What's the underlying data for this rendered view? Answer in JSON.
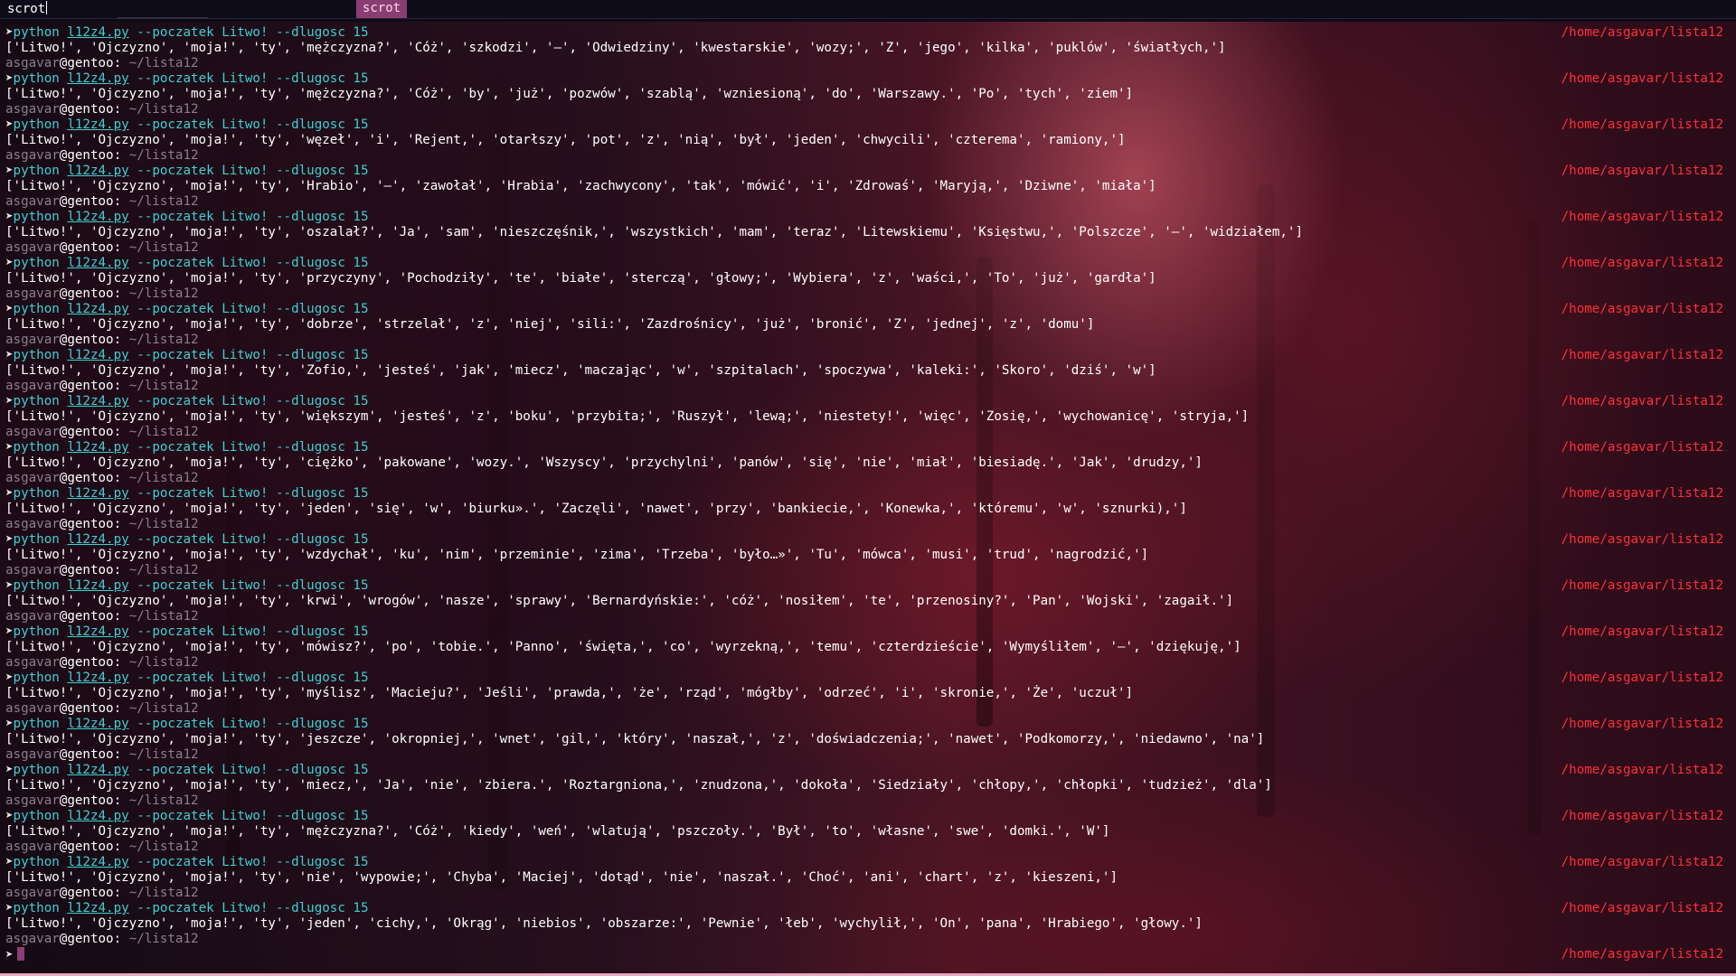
{
  "launcher": {
    "query": "scrot",
    "result": "scrot"
  },
  "terminal": {
    "prompt_char": "➤",
    "user": "asgavar",
    "host": "@gentoo:",
    "cwd": "~/lista12",
    "right_path": "/home/asgavar/lista12",
    "cmd_python": "python",
    "script": "l12z4.py",
    "args": "--poczatek Litwo! --dlugosc 15",
    "outputs": [
      "['Litwo!', 'Ojczyzno', 'moja!', 'ty', 'mężczyzna?', 'Cóż', 'szkodzi', '—', 'Odwiedziny', 'kwestarskie', 'wozy;', 'Z', 'jego', 'kilka', 'puklów', 'światłych,']",
      "['Litwo!', 'Ojczyzno', 'moja!', 'ty', 'mężczyzna?', 'Cóż', 'by', 'już', 'pozwów', 'szablą', 'wzniesioną', 'do', 'Warszawy.', 'Po', 'tych', 'ziem']",
      "['Litwo!', 'Ojczyzno', 'moja!', 'ty', 'węzeł', 'i', 'Rejent,', 'otarłszy', 'pot', 'z', 'nią', 'był', 'jeden', 'chwycili', 'czterema', 'ramiony,']",
      "['Litwo!', 'Ojczyzno', 'moja!', 'ty', 'Hrabio', '—', 'zawołał', 'Hrabia', 'zachwycony', 'tak', 'mówić', 'i', 'Zdrowaś', 'Maryją,', 'Dziwne', 'miała']",
      "['Litwo!', 'Ojczyzno', 'moja!', 'ty', 'oszalał?', 'Ja', 'sam', 'nieszczęśnik,', 'wszystkich', 'mam', 'teraz', 'Litewskiemu', 'Księstwu,', 'Polszcze', '—', 'widziałem,']",
      "['Litwo!', 'Ojczyzno', 'moja!', 'ty', 'przyczyny', 'Pochodziły', 'te', 'białe', 'sterczą', 'głowy;', 'Wybiera', 'z', 'waści,', 'To', 'już', 'gardła']",
      "['Litwo!', 'Ojczyzno', 'moja!', 'ty', 'dobrze', 'strzelał', 'z', 'niej', 'sili:', 'Zazdrośnicy', 'już', 'bronić', 'Z', 'jednej', 'z', 'domu']",
      "['Litwo!', 'Ojczyzno', 'moja!', 'ty', 'Zofio,', 'jesteś', 'jak', 'miecz', 'maczając', 'w', 'szpitalach', 'spoczywa', 'kaleki:', 'Skoro', 'dziś', 'w']",
      "['Litwo!', 'Ojczyzno', 'moja!', 'ty', 'większym', 'jesteś', 'z', 'boku', 'przybita;', 'Ruszył', 'lewą;', 'niestety!', 'więc', 'Zosię,', 'wychowanicę', 'stryja,']",
      "['Litwo!', 'Ojczyzno', 'moja!', 'ty', 'ciężko', 'pakowane', 'wozy.', 'Wszyscy', 'przychylni', 'panów', 'się', 'nie', 'miał', 'biesiadę.', 'Jak', 'drudzy,']",
      "['Litwo!', 'Ojczyzno', 'moja!', 'ty', 'jeden', 'się', 'w', 'biurku».', 'Zaczęli', 'nawet', 'przy', 'bankiecie,', 'Konewka,', 'któremu', 'w', 'sznurki),']",
      "['Litwo!', 'Ojczyzno', 'moja!', 'ty', 'wzdychał', 'ku', 'nim', 'przeminie', 'zima', 'Trzeba', 'było…»', 'Tu', 'mówca', 'musi', 'trud', 'nagrodzić,']",
      "['Litwo!', 'Ojczyzno', 'moja!', 'ty', 'krwi', 'wrogów', 'nasze', 'sprawy', 'Bernardyńskie:', 'cóż', 'nosiłem', 'te', 'przenosiny?', 'Pan', 'Wojski', 'zagaił.']",
      "['Litwo!', 'Ojczyzno', 'moja!', 'ty', 'mówisz?', 'po', 'tobie.', 'Panno', 'święta,', 'co', 'wyrzekną,', 'temu', 'czterdzieście', 'Wymyśliłem', '—', 'dziękuję,']",
      "['Litwo!', 'Ojczyzno', 'moja!', 'ty', 'myślisz', 'Macieju?', 'Jeśli', 'prawda,', 'że', 'rząd', 'mógłby', 'odrzeć', 'i', 'skronie,', 'Że', 'uczuł']",
      "['Litwo!', 'Ojczyzno', 'moja!', 'ty', 'jeszcze', 'okropniej,', 'wnet', 'gil,', 'który', 'naszał,', 'z', 'doświadczenia;', 'nawet', 'Podkomorzy,', 'niedawno', 'na']",
      "['Litwo!', 'Ojczyzno', 'moja!', 'ty', 'miecz,', 'Ja', 'nie', 'zbiera.', 'Roztargniona,', 'znudzona,', 'dokoła', 'Siedziały', 'chłopy,', 'chłopki', 'tudzież', 'dla']",
      "['Litwo!', 'Ojczyzno', 'moja!', 'ty', 'mężczyzna?', 'Cóż', 'kiedy', 'weń', 'wlatują', 'pszczoły.', 'Był', 'to', 'własne', 'swe', 'domki.', 'W']",
      "['Litwo!', 'Ojczyzno', 'moja!', 'ty', 'nie', 'wypowie;', 'Chyba', 'Maciej', 'dotąd', 'nie', 'naszał.', 'Choć', 'ani', 'chart', 'z', 'kieszeni,']",
      "['Litwo!', 'Ojczyzno', 'moja!', 'ty', 'jeden', 'cichy,', 'Okrąg', 'niebios', 'obszarze:', 'Pewnie', 'łeb', 'wychylił,', 'On', 'pana', 'Hrabiego', 'głowy.']"
    ]
  },
  "colors": {
    "command": "#3fd0d0",
    "right_path": "#ff2f3a",
    "launcher_selected": "#8a3d73",
    "dim_text": "#8a7f8a"
  }
}
